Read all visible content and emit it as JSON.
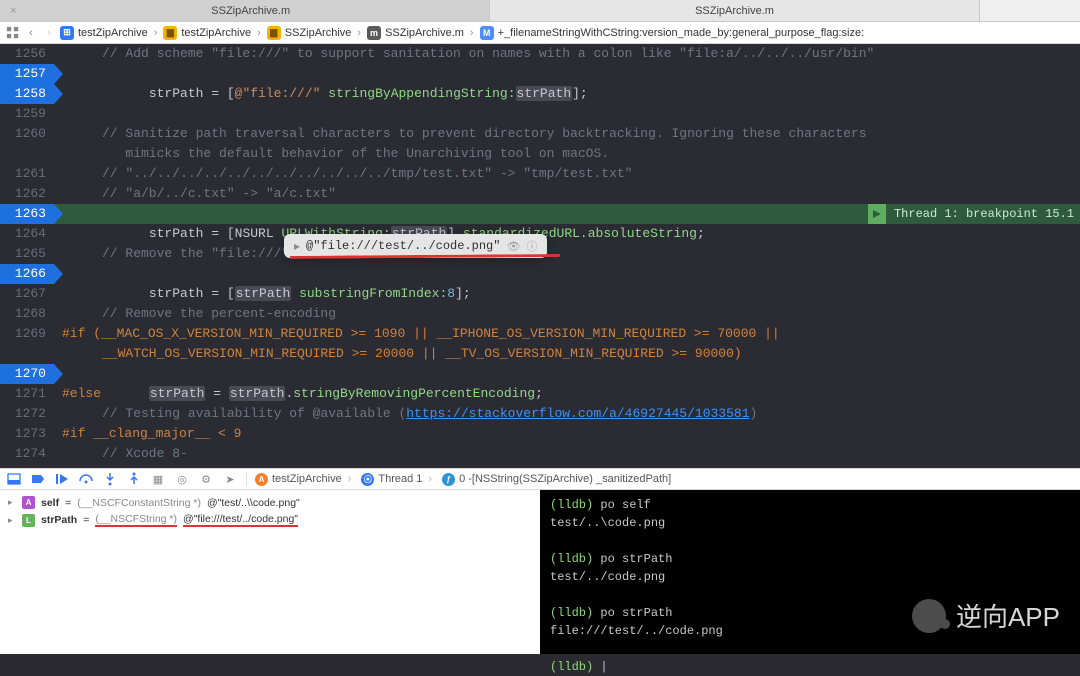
{
  "tabs": [
    {
      "title": "SSZipArchive.m",
      "active": true
    },
    {
      "title": "SSZipArchive.m",
      "active": false
    }
  ],
  "jumpbar": {
    "project": "testZipArchive",
    "group1": "testZipArchive",
    "group2": "SSZipArchive",
    "file": "SSZipArchive.m",
    "method": "+_filenameStringWithCString:version_made_by:general_purpose_flag:size:"
  },
  "lines": {
    "l1256_num": "1256",
    "l1256": "// Add scheme \"file:///\" to support sanitation on names with a colon like \"file:a/../../../usr/bin\"",
    "l1257_num": "1257",
    "l1257_pre": "strPath = [",
    "l1257_str": "@\"file:///\"",
    "l1257_sel": "stringByAppendingString:",
    "l1257_arg": "strPath",
    "l1257_end": "];",
    "l1258_num": "1258",
    "l1259_num": "1259",
    "l1260_num": "1260",
    "l1260": "// Sanitize path traversal characters to prevent directory backtracking. Ignoring these characters",
    "l1260b": "   mimicks the default behavior of the Unarchiving tool on macOS.",
    "l1261_num": "1261",
    "l1261": "// \"../../../../../../../../../../../tmp/test.txt\" -> \"tmp/test.txt\"",
    "l1262_num": "1262",
    "l1262": "// \"a/b/../c.txt\" -> \"a/c.txt\"",
    "l1263_num": "1263",
    "l1263_a": "strPath = [",
    "l1263_b": "NSURL",
    "l1263_c": "URLWithString:",
    "l1263_d": "strPath",
    "l1263_e": "].",
    "l1263_f": "standardizedURL.",
    "l1263_g": "absoluteString",
    "l1263_h": ";",
    "l1264_num": "1264",
    "l1265_num": "1265",
    "l1265": "// Remove the \"file:///\" scheme",
    "l1266_num": "1266",
    "l1266_a": "strPath = [",
    "l1266_b": "strPath",
    "l1266_c": "substringFromIndex:",
    "l1266_d": "8",
    "l1266_e": "];",
    "l1267_num": "1267",
    "l1268_num": "1268",
    "l1268": "// Remove the percent-encoding",
    "l1269_num": "1269",
    "l1269_a": "#if ",
    "l1269_b": "(__MAC_OS_X_VERSION_MIN_REQUIRED >= 1090 || __IPHONE_OS_VERSION_MIN_REQUIRED >= 70000 ||",
    "l1269b": "__WATCH_OS_VERSION_MIN_REQUIRED >= 20000 || __TV_OS_VERSION_MIN_REQUIRED >= 90000)",
    "l1270_num": "1270",
    "l1270_a": "strPath",
    "l1270_b": " = ",
    "l1270_c": "strPath",
    "l1270_d": ".",
    "l1270_e": "stringByRemovingPercentEncoding",
    "l1270_f": ";",
    "l1271_num": "1271",
    "l1271": "#else",
    "l1272_num": "1272",
    "l1272": "// Testing availability of @available (",
    "l1272_url": "https://stackoverflow.com/a/46927445/1033581",
    "l1272_end": ")",
    "l1273_num": "1273",
    "l1273_a": "#if ",
    "l1273_b": "__clang_major__ < 9",
    "l1274_num": "1274",
    "l1274": "// Xcode 8-"
  },
  "bpstatus": "Thread 1: breakpoint 15.1",
  "popover": {
    "text": "@\"file:///test/../code.png\""
  },
  "dbg_crumbs": {
    "process": "testZipArchive",
    "thread": "Thread 1",
    "frame": "0 -[NSString(SSZipArchive) _sanitizedPath]"
  },
  "vars": [
    {
      "badge": "A",
      "name": "self",
      "type": "(__NSCFConstantString *)",
      "value": "@\"test/..\\\\code.png\""
    },
    {
      "badge": "L",
      "name": "strPath",
      "type": "(__NSCFString *)",
      "value": "@\"file:///test/../code.png\""
    }
  ],
  "console": [
    {
      "prompt": "(lldb)",
      "cmd": "po self"
    },
    {
      "out": "test/..\\code.png"
    },
    {
      "blank": true
    },
    {
      "prompt": "(lldb)",
      "cmd": "po strPath"
    },
    {
      "out": "test/../code.png"
    },
    {
      "blank": true
    },
    {
      "prompt": "(lldb)",
      "cmd": "po strPath"
    },
    {
      "out": "file:///test/../code.png"
    },
    {
      "blank": true
    },
    {
      "prompt": "(lldb)",
      "cmd": "",
      "cursor": true
    }
  ],
  "watermark": "逆向APP"
}
